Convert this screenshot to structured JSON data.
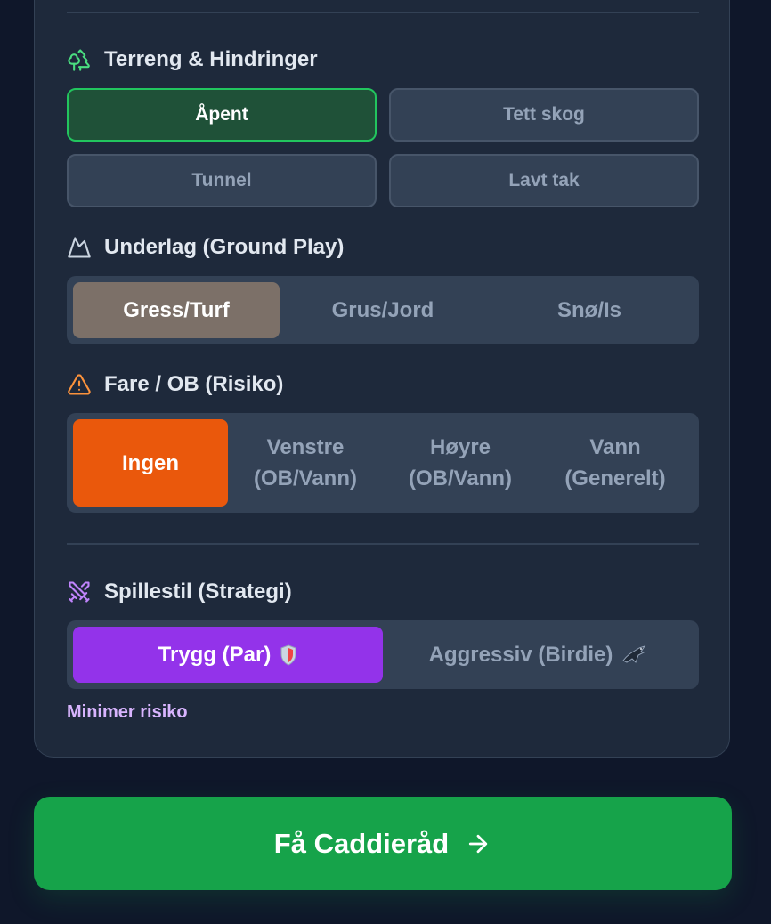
{
  "terrain": {
    "title": "Terreng & Hindringer",
    "icon": "trees-icon",
    "options": [
      "Åpent",
      "Tett skog",
      "Tunnel",
      "Lavt tak"
    ],
    "selected": "Åpent"
  },
  "ground": {
    "title": "Underlag (Ground Play)",
    "icon": "mountain-icon",
    "options": [
      "Gress/Turf",
      "Grus/Jord",
      "Snø/Is"
    ],
    "selected": "Gress/Turf"
  },
  "hazard": {
    "title": "Fare / OB (Risiko)",
    "icon": "warning-icon",
    "options": [
      {
        "line1": "Ingen",
        "line2": ""
      },
      {
        "line1": "Venstre",
        "line2": "(OB/Vann)"
      },
      {
        "line1": "Høyre",
        "line2": "(OB/Vann)"
      },
      {
        "line1": "Vann",
        "line2": "(Generelt)"
      }
    ],
    "selected": "Ingen"
  },
  "style": {
    "title": "Spillestil (Strategi)",
    "icon": "swords-icon",
    "options": [
      "Trygg (Par)",
      "Aggressiv (Birdie)"
    ],
    "selected": "Trygg (Par)",
    "hint": "Minimer risiko"
  },
  "cta": {
    "label": "Få Caddieråd",
    "icon": "arrow-right-icon"
  },
  "colors": {
    "accent_green": "#22c55e",
    "turf": "#7c7068",
    "orange": "#ea580c",
    "purple": "#9333ea",
    "cta": "#16a34a"
  }
}
